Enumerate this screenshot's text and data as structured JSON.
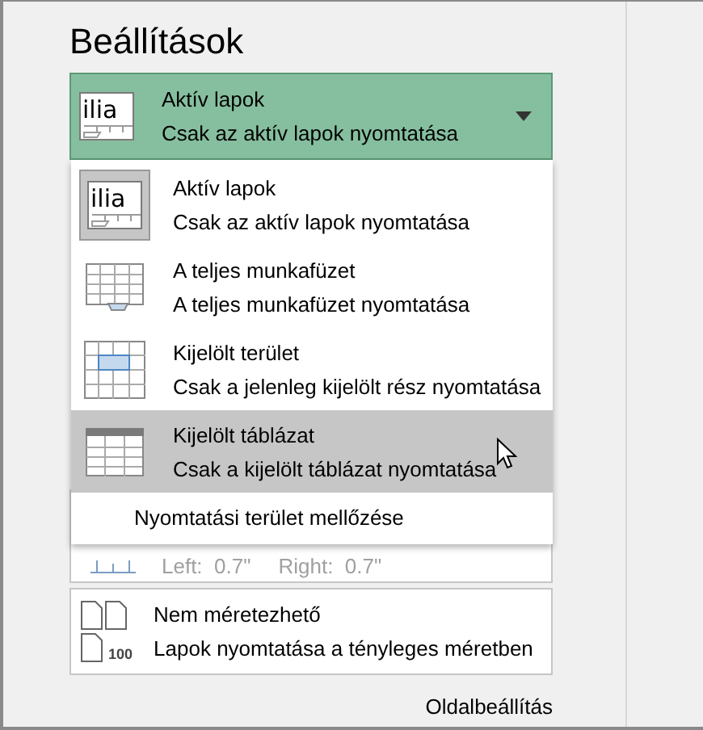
{
  "title": "Beállítások",
  "print_what": {
    "kind": "active_sheets",
    "icon_text": "ilia",
    "label": "Aktív lapok",
    "description": "Csak az aktív lapok nyomtatása",
    "expanded": true
  },
  "menu": {
    "items": [
      {
        "kind": "active_sheets",
        "icon_text": "ilia",
        "label": "Aktív lapok",
        "description": "Csak az aktív lapok nyomtatása",
        "selected": true,
        "hovered": false
      },
      {
        "kind": "workbook",
        "label": "A teljes munkafüzet",
        "description": "A teljes munkafüzet nyomtatása",
        "selected": false,
        "hovered": false
      },
      {
        "kind": "selection",
        "label": "Kijelölt terület",
        "description": "Csak a jelenleg kijelölt rész nyomtatása",
        "selected": false,
        "hovered": false
      },
      {
        "kind": "table",
        "label": "Kijelölt táblázat",
        "description": "Csak a kijelölt táblázat nyomtatása",
        "selected": false,
        "hovered": true
      }
    ],
    "ignore_print_area": "Nyomtatási terület mellőzése"
  },
  "margins": {
    "left": "Left:  0.7\"",
    "right": "Right:  0.7\""
  },
  "scaling": {
    "icon_text": "100",
    "label": "Nem méretezhető",
    "description": "Lapok nyomtatása a tényleges méretben"
  },
  "page_setup_link": "Oldalbeállítás"
}
